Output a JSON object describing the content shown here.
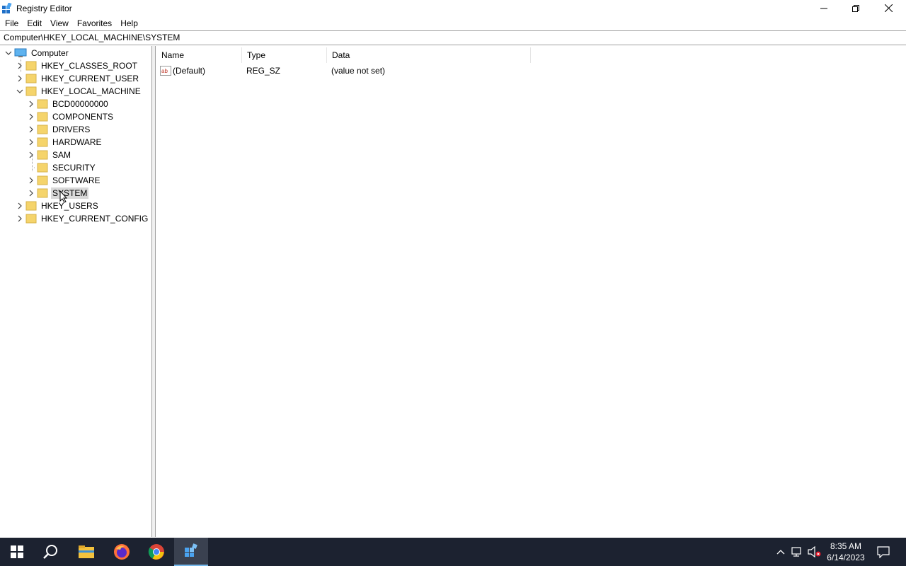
{
  "window": {
    "title": "Registry Editor",
    "minimize_icon": "minimize-icon",
    "maximize_icon": "restore-icon",
    "close_icon": "close-icon"
  },
  "menu": [
    "File",
    "Edit",
    "View",
    "Favorites",
    "Help"
  ],
  "address": "Computer\\HKEY_LOCAL_MACHINE\\SYSTEM",
  "tree": {
    "root": "Computer",
    "hives": {
      "classes_root": "HKEY_CLASSES_ROOT",
      "current_user": "HKEY_CURRENT_USER",
      "local_machine": "HKEY_LOCAL_MACHINE",
      "users": "HKEY_USERS",
      "current_config": "HKEY_CURRENT_CONFIG"
    },
    "local_machine_children": [
      "BCD00000000",
      "COMPONENTS",
      "DRIVERS",
      "HARDWARE",
      "SAM",
      "SECURITY",
      "SOFTWARE",
      "SYSTEM"
    ],
    "selected": "SYSTEM"
  },
  "list": {
    "columns": [
      "Name",
      "Type",
      "Data"
    ],
    "rows": [
      {
        "name": "(Default)",
        "type": "REG_SZ",
        "data": "(value not set)",
        "icon": "string-value-icon"
      }
    ]
  },
  "taskbar": {
    "apps": [
      "start-icon",
      "search-icon",
      "file-explorer-icon",
      "firefox-icon",
      "chrome-icon",
      "registry-editor-icon"
    ],
    "active_app": "registry-editor-icon",
    "time": "8:35 AM",
    "date": "6/14/2023"
  },
  "colors": {
    "taskbar_bg": "#1c2230",
    "folder": "#f5d46b",
    "selection": "#d9d9d9",
    "active_indicator": "#76b9ed"
  }
}
